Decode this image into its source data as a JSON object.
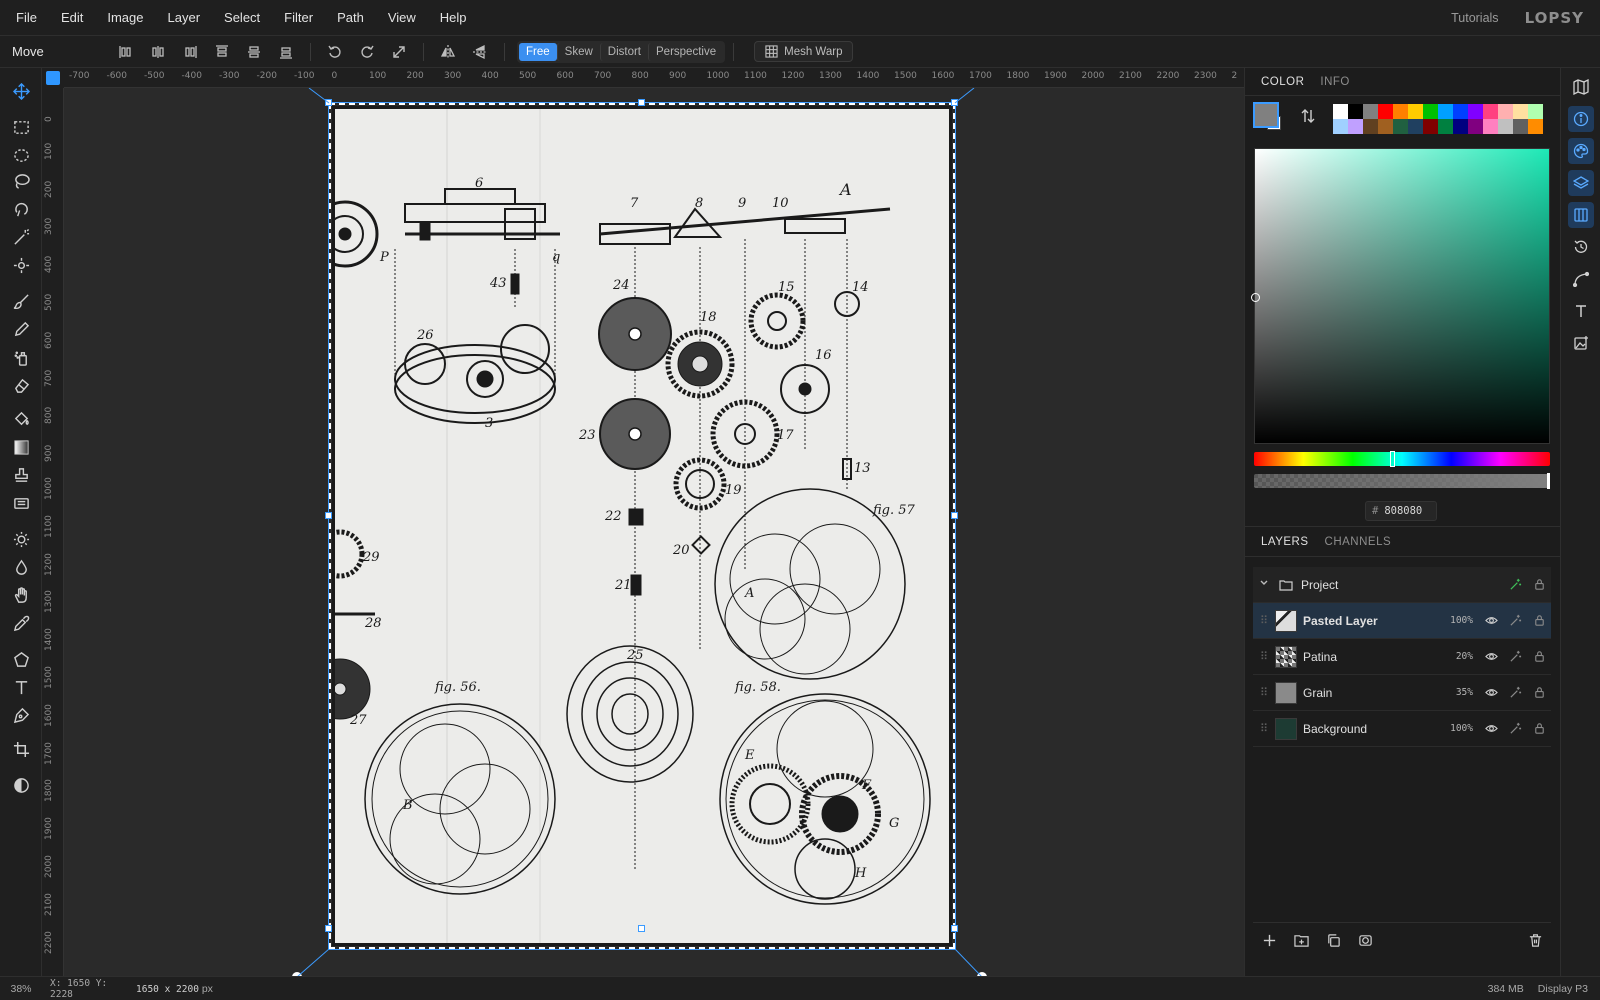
{
  "menu": [
    "File",
    "Edit",
    "Image",
    "Layer",
    "Select",
    "Filter",
    "Path",
    "View",
    "Help"
  ],
  "header": {
    "tutorials": "Tutorials",
    "brand": "LOPSY"
  },
  "options": {
    "tool_name": "Move",
    "modes": [
      "Free",
      "Skew",
      "Distort",
      "Perspective"
    ],
    "active_mode": "Free",
    "mesh_warp": "Mesh Warp"
  },
  "rulers": {
    "h_ticks": [
      "-700",
      "-600",
      "-500",
      "-400",
      "-300",
      "-200",
      "-100",
      "0",
      "100",
      "200",
      "300",
      "400",
      "500",
      "600",
      "700",
      "800",
      "900",
      "1000",
      "1100",
      "1200",
      "1300",
      "1400",
      "1500",
      "1600",
      "1700",
      "1800",
      "1900",
      "2000",
      "2100",
      "2200",
      "2300",
      "2"
    ],
    "v_ticks": [
      "0",
      "100",
      "200",
      "300",
      "400",
      "500",
      "600",
      "700",
      "800",
      "900",
      "1000",
      "1100",
      "1200",
      "1300",
      "1400",
      "1500",
      "1600",
      "1700",
      "1800",
      "1900",
      "2000",
      "2100",
      "2200"
    ]
  },
  "document": {
    "labels": {
      "n6": "6",
      "n7": "7",
      "n8": "8",
      "n9": "9",
      "n10": "10",
      "nA": "A",
      "n43": "43",
      "nP": "P",
      "nq": "q",
      "n24": "24",
      "n18": "18",
      "n15": "15",
      "n14": "14",
      "n16": "16",
      "n26": "26",
      "n3": "3",
      "n23": "23",
      "n17": "17",
      "n19": "19",
      "n13": "13",
      "n22": "22",
      "n20": "20",
      "n21": "21",
      "fig57": "fig. 57",
      "n29": "29",
      "n28": "28",
      "n25": "25",
      "fig56": "fig. 56.",
      "fig58": "fig. 58.",
      "n27": "27",
      "nB": "B",
      "nE": "E",
      "nF": "F",
      "nG": "G",
      "nH": "H",
      "nA2": "A"
    }
  },
  "color_panel": {
    "tabs": [
      "COLOR",
      "INFO"
    ],
    "active_tab": "COLOR",
    "foreground": "#808080",
    "background": "#ffffff",
    "hex_value": "808080",
    "hex_prefix": "#",
    "hue_base": "#1de9b6",
    "palette": [
      "#ffffff",
      "#000000",
      "#808080",
      "#ff0000",
      "#ff8000",
      "#ffcc00",
      "#00c000",
      "#00a0ff",
      "#0040ff",
      "#8000ff",
      "#ff4080",
      "#ffb0b0",
      "#ffe0a0",
      "#b0ffb0",
      "#a0d0ff",
      "#c0a0ff",
      "#604020",
      "#a06020",
      "#206040",
      "#204060",
      "#800000",
      "#008040",
      "#000080",
      "#800080",
      "#ff80c0",
      "#c0c0c0",
      "#606060",
      "#ff8c00"
    ],
    "palette_row2_extra": [
      "#ff7f00",
      "#00c0c0"
    ]
  },
  "layers_panel": {
    "tabs": [
      "LAYERS",
      "CHANNELS"
    ],
    "active_tab": "LAYERS",
    "group": {
      "name": "Project"
    },
    "layers": [
      {
        "name": "Pasted Layer",
        "opacity": "100%",
        "selected": true,
        "thumb": "pasted"
      },
      {
        "name": "Patina",
        "opacity": "20%",
        "selected": false,
        "thumb": "patina"
      },
      {
        "name": "Grain",
        "opacity": "35%",
        "selected": false,
        "thumb": "grain"
      },
      {
        "name": "Background",
        "opacity": "100%",
        "selected": false,
        "thumb": "background"
      }
    ]
  },
  "status": {
    "zoom": "38%",
    "coords": "X: 1650 Y: 2228",
    "dims_value": "1650 x 2200",
    "dims_unit": "px",
    "memory": "384 MB",
    "color_profile": "Display P3"
  }
}
